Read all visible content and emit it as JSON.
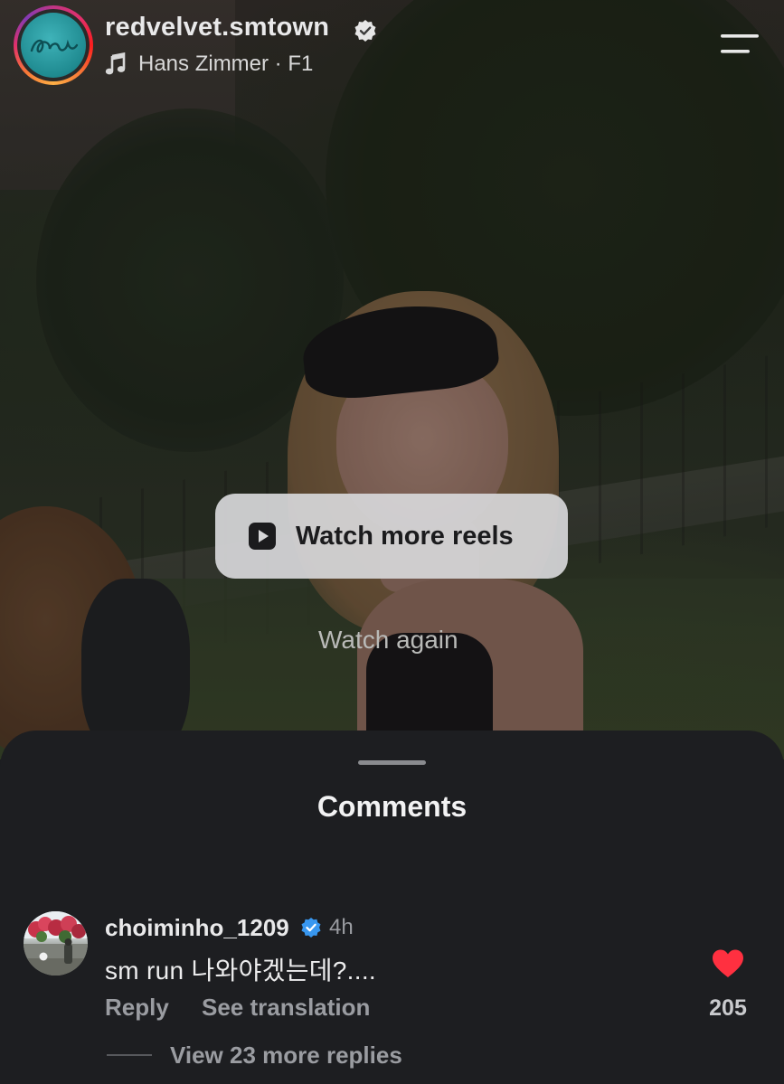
{
  "header": {
    "username": "redvelvet.smtown",
    "audio": "Hans Zimmer · F1"
  },
  "overlay": {
    "watch_more_label": "Watch more reels",
    "watch_again_label": "Watch again"
  },
  "comments": {
    "title": "Comments",
    "items": [
      {
        "username": "choiminho_1209",
        "time": "4h",
        "text": "sm run  나와야겠는데?....",
        "reply_label": "Reply",
        "translate_label": "See translation",
        "likes": "205",
        "view_replies_label": "View 23 more replies"
      }
    ]
  },
  "colors": {
    "verified_badge": "#3897f0",
    "heart": "#ff3040",
    "sheet_bg": "#1d1e21"
  },
  "icons": {
    "verified": "verified-badge-icon",
    "music": "music-note-icon",
    "menu": "menu-icon",
    "play": "play-icon",
    "like": "heart-icon"
  }
}
